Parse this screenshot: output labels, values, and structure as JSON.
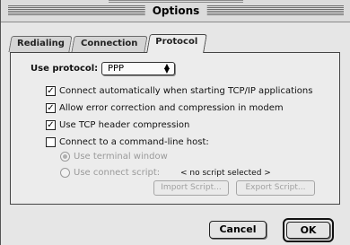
{
  "window": {
    "title": "Options"
  },
  "tabs": [
    {
      "label": "Redialing"
    },
    {
      "label": "Connection"
    },
    {
      "label": "Protocol"
    }
  ],
  "protocol": {
    "label": "Use protocol:",
    "selected": "PPP"
  },
  "options": [
    {
      "label": "Connect automatically when starting TCP/IP applications",
      "checked": true
    },
    {
      "label": "Allow error correction and compression in modem",
      "checked": true
    },
    {
      "label": "Use TCP header compression",
      "checked": true
    },
    {
      "label": "Connect to a command-line host:",
      "checked": false
    }
  ],
  "host": {
    "terminal_label": "Use terminal window",
    "script_label": "Use connect script:",
    "script_value": "< no script selected >",
    "import_label": "Import Script...",
    "export_label": "Export Script..."
  },
  "buttons": {
    "cancel": "Cancel",
    "ok": "OK"
  }
}
